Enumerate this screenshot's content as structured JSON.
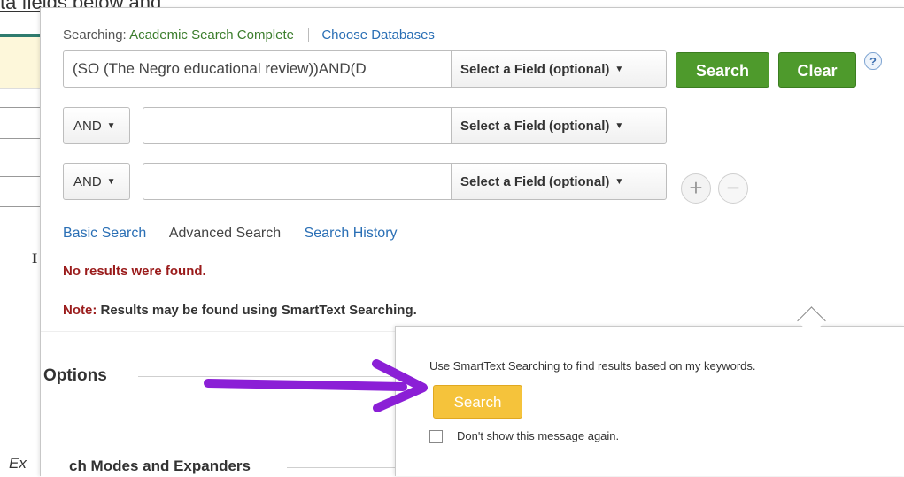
{
  "background": {
    "top_text": "ta fields below and",
    "letter": "I",
    "footer_text": "Ex"
  },
  "searching": {
    "label": "Searching:",
    "database": "Academic Search Complete",
    "choose_link": "Choose Databases"
  },
  "rows": [
    {
      "query": "(SO (The Negro educational review))AND(D",
      "field": "Select a Field (optional)"
    },
    {
      "bool": "AND",
      "query": "",
      "field": "Select a Field (optional)"
    },
    {
      "bool": "AND",
      "query": "",
      "field": "Select a Field (optional)"
    }
  ],
  "buttons": {
    "search": "Search",
    "clear": "Clear",
    "help": "?",
    "add": "+",
    "remove": "−"
  },
  "links": {
    "basic": "Basic Search",
    "advanced": "Advanced Search",
    "history": "Search History"
  },
  "messages": {
    "no_results": "No results were found.",
    "note_label": "Note:",
    "note_text": "Results may be found using SmartText Searching."
  },
  "sections": {
    "options": "Options",
    "modes": "ch Modes and Expanders"
  },
  "popup": {
    "text": "Use SmartText Searching to find results based on my keywords.",
    "search_button": "Search",
    "checkbox_label": "Don't show this message again."
  },
  "colors": {
    "green": "#4e9a2c",
    "yellow": "#f5c33b",
    "arrow": "#8b1fd6",
    "error": "#9a1b1b",
    "link": "#2a6fb5"
  }
}
